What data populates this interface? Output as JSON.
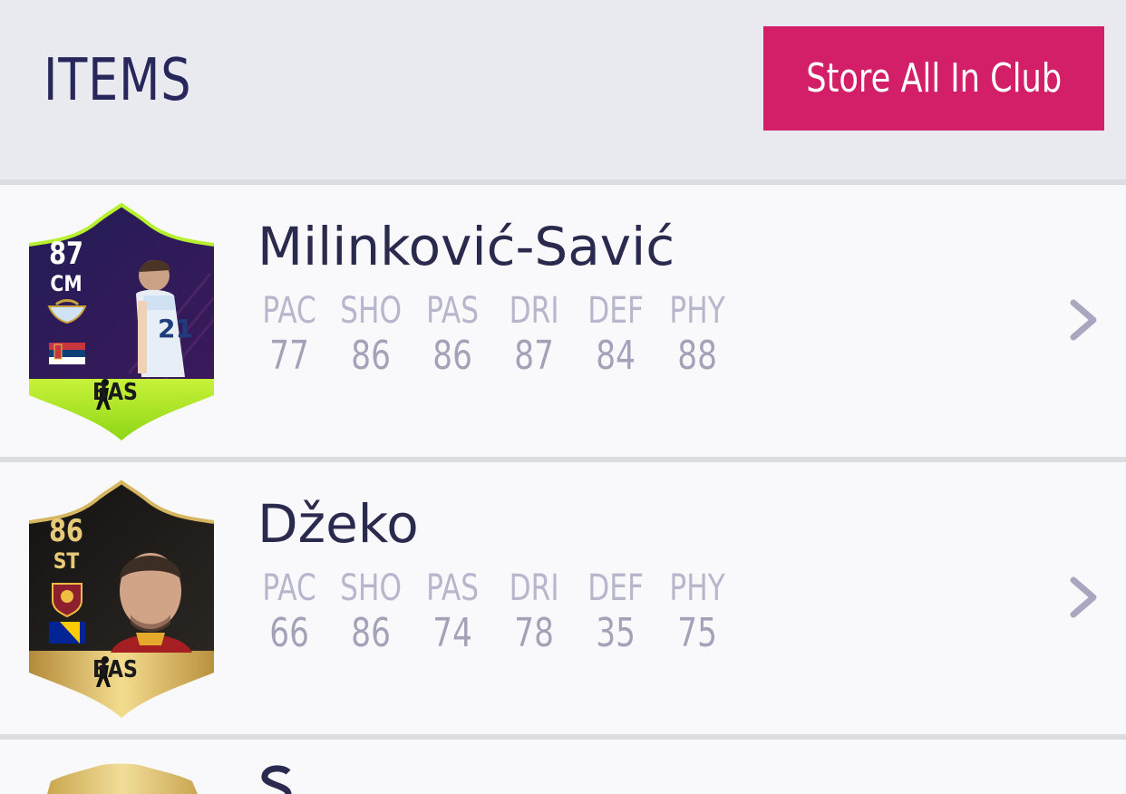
{
  "header": {
    "title": "ITEMS",
    "store_button_label": "Store All In Club"
  },
  "colors": {
    "accent": "#d21f68",
    "title": "#27275c",
    "background": "#e9eaef"
  },
  "items": [
    {
      "name": "Milinković-Savić",
      "card": {
        "rating": "87",
        "position": "CM",
        "chemistry_style": "BAS",
        "style": "purple-special"
      },
      "stats": [
        {
          "label": "PAC",
          "value": "77"
        },
        {
          "label": "SHO",
          "value": "86"
        },
        {
          "label": "PAS",
          "value": "86"
        },
        {
          "label": "DRI",
          "value": "87"
        },
        {
          "label": "DEF",
          "value": "84"
        },
        {
          "label": "PHY",
          "value": "88"
        }
      ]
    },
    {
      "name": "Džeko",
      "card": {
        "rating": "86",
        "position": "ST",
        "chemistry_style": "BAS",
        "style": "black-gold"
      },
      "stats": [
        {
          "label": "PAC",
          "value": "66"
        },
        {
          "label": "SHO",
          "value": "86"
        },
        {
          "label": "PAS",
          "value": "74"
        },
        {
          "label": "DRI",
          "value": "78"
        },
        {
          "label": "DEF",
          "value": "35"
        },
        {
          "label": "PHY",
          "value": "75"
        }
      ]
    }
  ]
}
